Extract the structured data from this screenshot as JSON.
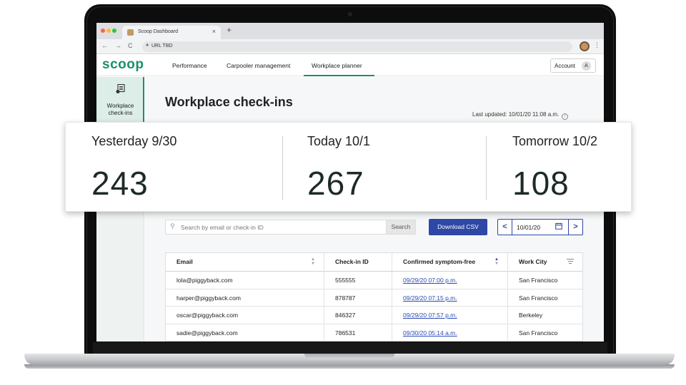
{
  "browser": {
    "tab_title": "Scoop Dashboard",
    "tab_close": "×",
    "new_tab": "+",
    "url": "URL TBD",
    "back": "←",
    "forward": "→",
    "reload": "C",
    "menu": "⋮"
  },
  "header": {
    "logo": "scoop",
    "nav": [
      "Performance",
      "Carpooler management",
      "Workplace planner"
    ],
    "active_nav": "Workplace planner",
    "account_label": "Account",
    "avatar_initial": "A"
  },
  "sidebar": {
    "items": [
      {
        "label": "Workplace check-ins",
        "icon": "checklist-icon",
        "active": true
      }
    ]
  },
  "page": {
    "title": "Workplace check-ins",
    "last_updated": "Last updated: 10/01/20 11:08 a.m.",
    "info_icon": "i"
  },
  "stats": [
    {
      "label": "Yesterday 9/30",
      "value": "243"
    },
    {
      "label": "Today 10/1",
      "value": "267"
    },
    {
      "label": "Tomorrow 10/2",
      "value": "108"
    }
  ],
  "toolbar": {
    "search_placeholder": "Search by email or check-in ID",
    "search_button": "Search",
    "download_button": "Download CSV",
    "date": "10/01/20",
    "prev": "<",
    "next": ">"
  },
  "table": {
    "columns": [
      "Email",
      "Check-in ID",
      "Confirmed symptom-free",
      "Work City"
    ],
    "rows": [
      [
        "lola@piggyback.com",
        "555555",
        "09/29/20 07:00 p.m.",
        "San Francisco"
      ],
      [
        "harper@piggyback.com",
        "878787",
        "09/29/20 07:15 p.m.",
        "San Francisco"
      ],
      [
        "oscar@piggyback.com",
        "846327",
        "09/29/20 07:57 p.m.",
        "Berkeley"
      ],
      [
        "sadie@piggyback.com",
        "786531",
        "09/30/20 05:14 a.m.",
        "San Francisco"
      ]
    ]
  },
  "colors": {
    "brand_green": "#1a8f6a",
    "primary_blue": "#2f47a6",
    "link_blue": "#2d4cb3"
  }
}
